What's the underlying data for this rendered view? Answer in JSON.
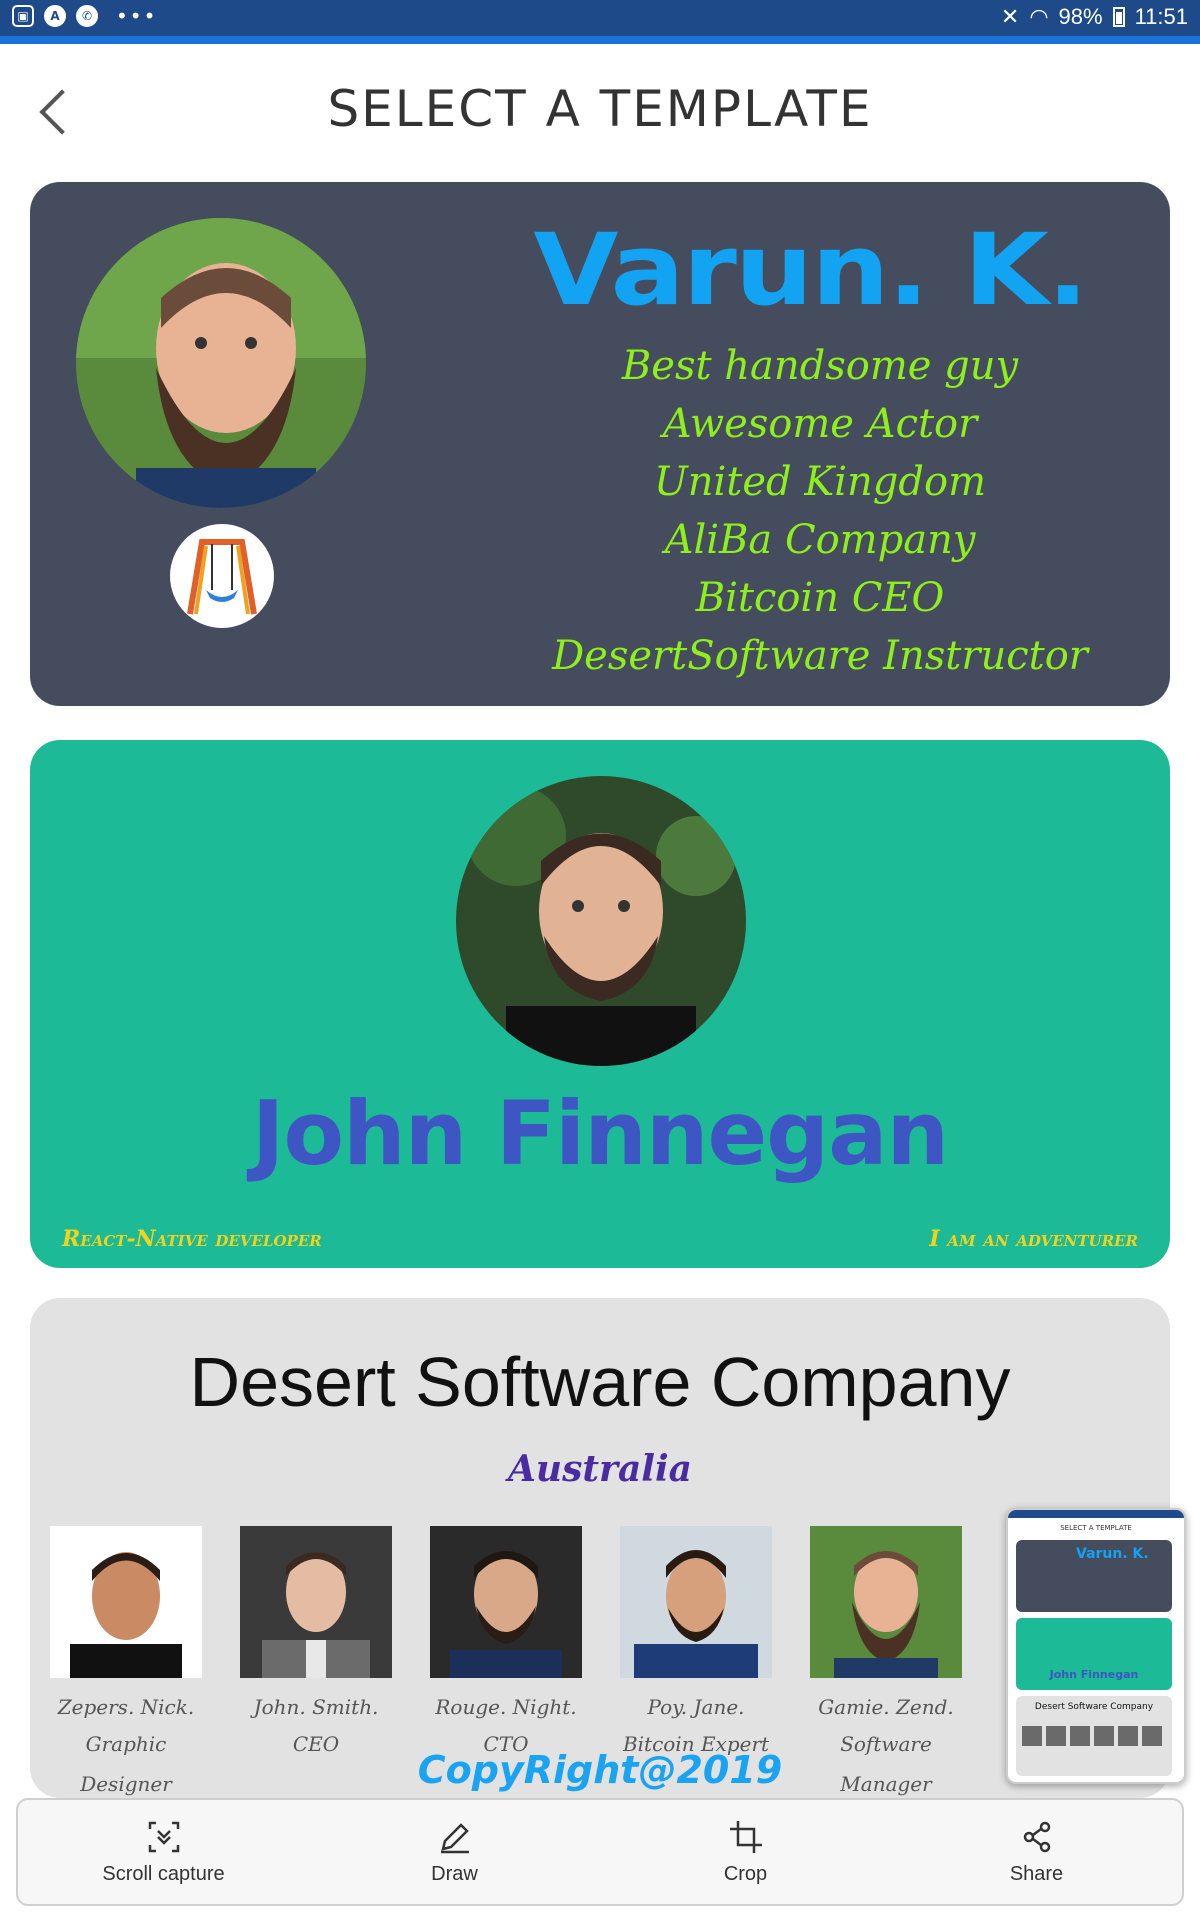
{
  "status_bar": {
    "wifi_battery": "98%",
    "time": "11:51",
    "left_icons": [
      "gallery-icon",
      "app-icon",
      "whatsapp-icon",
      "more-icon"
    ],
    "bar_color": "#1e4a8a"
  },
  "header": {
    "title": "SELECT A TEMPLATE"
  },
  "template1": {
    "name": "Varun. K.",
    "lines": [
      "Best handsome guy",
      "Awesome Actor",
      "United Kingdom",
      "AliBa Company",
      "Bitcoin CEO",
      "DesertSoftware Instructor"
    ],
    "background": "#454c5d",
    "name_color": "#12a3f2",
    "line_color": "#8ef01a"
  },
  "template2": {
    "name": "John Finnegan",
    "left_caption": "React-Native developer",
    "right_caption": "I am an adventurer",
    "background": "#1dba98",
    "name_color": "#3e55c4",
    "caption_color": "#f4d21a"
  },
  "template3": {
    "company": "Desert Software Company",
    "location": "Australia",
    "copyright": "CopyRight@2019",
    "members": [
      {
        "name": "Zepers. Nick.",
        "role": "Graphic Designer"
      },
      {
        "name": "John. Smith.",
        "role": "CEO"
      },
      {
        "name": "Rouge. Night.",
        "role": "CTO"
      },
      {
        "name": "Poy. Jane.",
        "role": "Bitcoin Expert"
      },
      {
        "name": "Gamie. Zend.",
        "role": "Software Manager"
      }
    ],
    "background": "#e2e2e2"
  },
  "thumbnail": {
    "title": "SELECT A TEMPLATE",
    "name1": "Varun. K.",
    "name2": "John Finnegan",
    "company": "Desert Software Company"
  },
  "toolbar": {
    "items": [
      {
        "label": "Scroll capture",
        "icon": "scroll-capture-icon"
      },
      {
        "label": "Draw",
        "icon": "pen-icon"
      },
      {
        "label": "Crop",
        "icon": "crop-icon"
      },
      {
        "label": "Share",
        "icon": "share-icon"
      }
    ]
  }
}
